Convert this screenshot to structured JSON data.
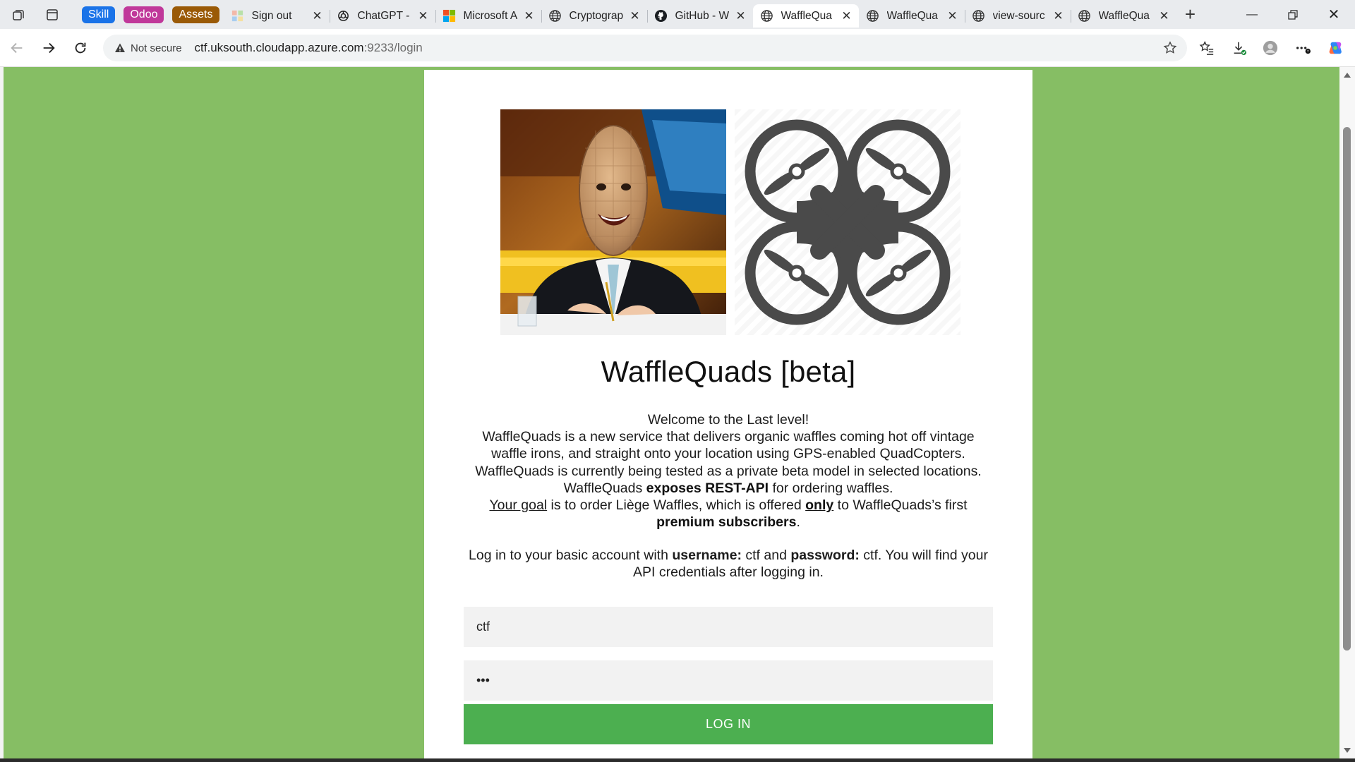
{
  "browser": {
    "tab_groups": [
      {
        "label": "Skill",
        "color": "#1a73e8"
      },
      {
        "label": "Odoo",
        "color": "#c0389a"
      },
      {
        "label": "Assets",
        "color": "#9a5a07"
      }
    ],
    "tabs": [
      {
        "title": "Sign out",
        "favicon": "microsoft-grid-icon"
      },
      {
        "title": "ChatGPT -",
        "favicon": "openai-icon"
      },
      {
        "title": "Microsoft A",
        "favicon": "microsoft-logo-icon"
      },
      {
        "title": "Cryptograp",
        "favicon": "globe-icon"
      },
      {
        "title": "GitHub - W",
        "favicon": "github-icon"
      },
      {
        "title": "WaffleQua",
        "favicon": "globe-icon",
        "active": true
      },
      {
        "title": "WaffleQua",
        "favicon": "globe-icon"
      },
      {
        "title": "view-sourc",
        "favicon": "globe-icon"
      },
      {
        "title": "WaffleQua",
        "favicon": "globe-icon"
      }
    ],
    "security_label": "Not secure",
    "url_host": "ctf.uksouth.cloudapp.azure.com",
    "url_rest": ":9233/login"
  },
  "page": {
    "title": "WaffleQuads [beta]",
    "intro": {
      "line1": "Welcome to the Last level!",
      "line2": "WaffleQuads is a new service that delivers organic waffles coming hot off vintage waffle irons, and straight onto your location using GPS-enabled QuadCopters.",
      "line3": "WaffleQuads is currently being tested as a private beta model in selected locations.",
      "line4_a": "WaffleQuads ",
      "line4_b": "exposes REST-API",
      "line4_c": " for ordering waffles.",
      "line5_a": "Your goal",
      "line5_b": " is to order Liège Waffles, which is offered ",
      "line5_c": "only",
      "line5_d": " to WaffleQuads’s first ",
      "line5_e": "premium subscribers",
      "line5_f": "."
    },
    "login_note": {
      "a": "Log in to your basic account with ",
      "b": "username:",
      "c": " ctf and ",
      "d": "password:",
      "e": " ctf. You will find your API credentials after logging in."
    },
    "username_value": "ctf",
    "password_value": "ctf",
    "login_button": "LOG IN",
    "colors": {
      "page_bg": "#86be64",
      "button": "#4caf50"
    }
  }
}
